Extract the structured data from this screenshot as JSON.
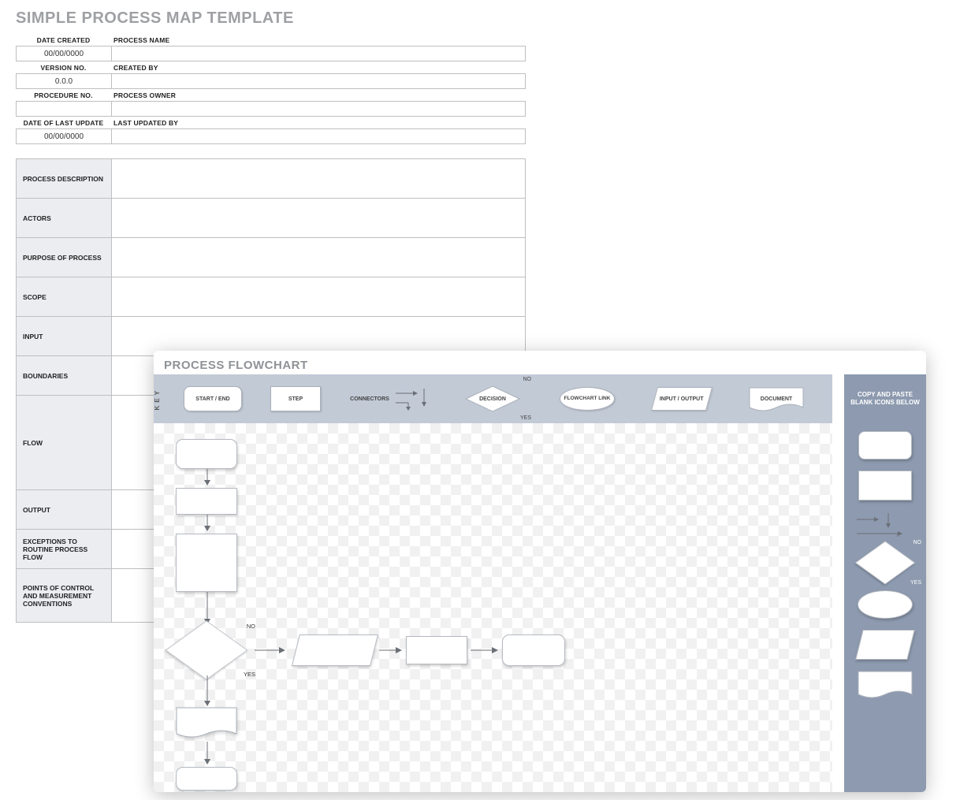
{
  "title": "SIMPLE PROCESS MAP TEMPLATE",
  "meta": {
    "rows": [
      {
        "left_label": "DATE CREATED",
        "left_value": "00/00/0000",
        "right_label": "PROCESS NAME",
        "right_value": ""
      },
      {
        "left_label": "VERSION NO.",
        "left_value": "0.0.0",
        "right_label": "CREATED BY",
        "right_value": ""
      },
      {
        "left_label": "PROCEDURE NO.",
        "left_value": "",
        "right_label": "PROCESS OWNER",
        "right_value": ""
      },
      {
        "left_label": "DATE OF LAST UPDATE",
        "left_value": "00/00/0000",
        "right_label": "LAST UPDATED BY",
        "right_value": ""
      }
    ]
  },
  "details": [
    {
      "label": "PROCESS DESCRIPTION",
      "value": "",
      "height": "h-sm"
    },
    {
      "label": "ACTORS",
      "value": "",
      "height": "h-sm"
    },
    {
      "label": "PURPOSE OF PROCESS",
      "value": "",
      "height": "h-sm"
    },
    {
      "label": "SCOPE",
      "value": "",
      "height": "h-sm"
    },
    {
      "label": "INPUT",
      "value": "",
      "height": "h-sm"
    },
    {
      "label": "BOUNDARIES",
      "value": "",
      "height": "h-sm"
    },
    {
      "label": "FLOW",
      "value": "",
      "height": "h-tall"
    },
    {
      "label": "OUTPUT",
      "value": "",
      "height": "h-sm"
    },
    {
      "label": "EXCEPTIONS TO ROUTINE PROCESS FLOW",
      "value": "",
      "height": "h-sm"
    },
    {
      "label": "POINTS OF CONTROL AND MEASUREMENT CONVENTIONS",
      "value": "",
      "height": "h-md"
    }
  ],
  "flowchart": {
    "title": "PROCESS FLOWCHART",
    "key_label": "KEY",
    "key": {
      "start_end": "START / END",
      "step": "STEP",
      "connectors": "CONNECTORS",
      "decision": "DECISION",
      "decision_no": "NO",
      "decision_yes": "YES",
      "flowchart_link": "FLOWCHART LINK",
      "input_output": "INPUT / OUTPUT",
      "document": "DOCUMENT"
    },
    "copy_paste": "COPY AND PASTE BLANK ICONS BELOW",
    "canvas": {
      "decision_no": "NO",
      "decision_yes": "YES"
    },
    "palette": {
      "decision_no": "NO",
      "decision_yes": "YES"
    }
  }
}
